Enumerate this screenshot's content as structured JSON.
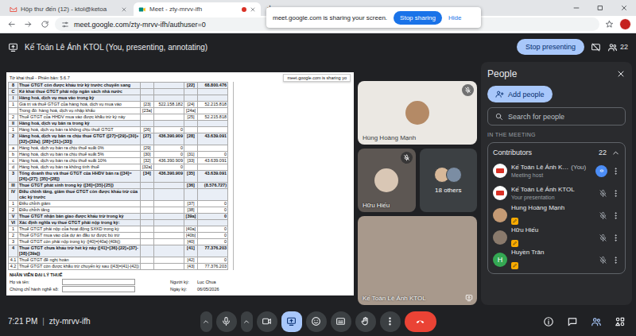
{
  "browser": {
    "tabs": [
      {
        "label": "Hộp thư đến (12) - ktol@ketoa",
        "selected": false,
        "kind": "mail",
        "recording": false
      },
      {
        "label": "Meet - zty-mrvv-ifh",
        "selected": true,
        "kind": "meet",
        "recording": true
      }
    ],
    "new_tab": "+",
    "url": "meet.google.com/zty-mrvv-ifh/authuser=0"
  },
  "share_notice": {
    "text": "meet.google.com is sharing your screen.",
    "stop": "Stop sharing",
    "hide": "Hide"
  },
  "meeting_bar": {
    "title": "Kế Toán Lê Ánh KTOL (You, presenting, annotating)",
    "stop_presenting": "Stop presenting",
    "participant_count": "22"
  },
  "document": {
    "title": "Tờ khai thuế - Phiên bản: 5.6.7",
    "notice": "meet.google.com is sharing yo",
    "rows": [
      {
        "kind": "section",
        "cells": [
          "8",
          "Thuế GTGT còn được khấu trừ kỳ trước chuyển sang",
          "",
          "",
          "[22]",
          "68.800.476"
        ]
      },
      {
        "kind": "section",
        "cells": [
          "C",
          "Kê khai thuế GTGT phải nộp ngân sách nhà nước",
          "",
          "",
          "",
          ""
        ]
      },
      {
        "kind": "section",
        "cells": [
          "I",
          "Hàng hoá, dịch vụ mua vào trong kỳ",
          "",
          "",
          "",
          ""
        ]
      },
      {
        "kind": "item",
        "cells": [
          "1",
          "Giá trị và thuế GTGT của hàng hoá, dịch vụ mua vào",
          "[23]",
          "522.158.182",
          "[24]",
          "52.215.818"
        ]
      },
      {
        "kind": "item",
        "cells": [
          "",
          "Trong đó: hàng hoá, dịch vụ nhập khẩu",
          "[23a]",
          "",
          "[24a]",
          ""
        ]
      },
      {
        "kind": "item",
        "cells": [
          "2",
          "Thuế GTGT của HHDV mua vào được khấu trừ kỳ này",
          "",
          "",
          "[25]",
          "52.215.818"
        ]
      },
      {
        "kind": "section",
        "cells": [
          "II",
          "Hàng hoá, dịch vụ bán ra trong kỳ",
          "",
          "",
          "",
          ""
        ]
      },
      {
        "kind": "item",
        "cells": [
          "1",
          "Hàng hoá, dịch vụ bán ra không chịu thuế GTGT",
          "[26]",
          "0",
          "",
          ""
        ]
      },
      {
        "kind": "section",
        "cells": [
          "2",
          "Hàng hoá, dịch vụ bán ra chịu thuế GTGT ([27]=[29]+[30]+[32]+[32a]; [28]=[31]+[33])",
          "[27]",
          "436.390.909",
          "[28]",
          "43.639.091"
        ]
      },
      {
        "kind": "item",
        "cells": [
          "a",
          "Hàng hoá, dịch vụ bán ra chịu thuế suất 0%",
          "[29]",
          "0",
          "",
          ""
        ]
      },
      {
        "kind": "item",
        "cells": [
          "b",
          "Hàng hoá, dịch vụ bán ra chịu thuế suất 5%",
          "[30]",
          "0",
          "[31]",
          "0"
        ]
      },
      {
        "kind": "item",
        "cells": [
          "c",
          "Hàng hoá, dịch vụ bán ra chịu thuế suất 10%",
          "[32]",
          "436.390.909",
          "[33]",
          "43.639.091"
        ]
      },
      {
        "kind": "item",
        "cells": [
          "d",
          "Hàng hoá, dịch vụ bán ra không tính thuế",
          "[32a]",
          "0",
          "",
          ""
        ]
      },
      {
        "kind": "section",
        "cells": [
          "3",
          "Tổng doanh thu và thuế GTGT của HHDV bán ra ([34]=[26]+[27]; [35]=[28])",
          "[34]",
          "436.390.909",
          "[35]",
          "43.639.091"
        ]
      },
      {
        "kind": "section",
        "cells": [
          "III",
          "Thuế GTGT phát sinh trong kỳ ([36]=[35]-[25])",
          "",
          "",
          "[36]",
          "(8.576.727)"
        ]
      },
      {
        "kind": "section",
        "cells": [
          "IV",
          "Điều chỉnh tăng, giảm thuế GTGT còn được khấu trừ của các kỳ trước",
          "",
          "",
          "",
          ""
        ]
      },
      {
        "kind": "item",
        "cells": [
          "1",
          "Điều chỉnh giảm",
          "",
          "",
          "[37]",
          "0"
        ]
      },
      {
        "kind": "item",
        "cells": [
          "2",
          "Điều chỉnh tăng",
          "",
          "",
          "[38]",
          "0"
        ]
      },
      {
        "kind": "section",
        "cells": [
          "V",
          "Thuế GTGT nhận bàn giao được khấu trừ trong kỳ",
          "",
          "",
          "[39a]",
          "0"
        ]
      },
      {
        "kind": "section",
        "cells": [
          "VI",
          "Xác định nghĩa vụ thuế GTGT phải nộp trong kỳ:",
          "",
          "",
          "",
          ""
        ]
      },
      {
        "kind": "item",
        "cells": [
          "1",
          "Thuế GTGT phải nộp của hoạt động SXKD trong kỳ",
          "",
          "",
          "[40a]",
          "0"
        ]
      },
      {
        "kind": "item",
        "cells": [
          "2",
          "Thuế GTGT mua vào của dự án đầu tư được bù trừ",
          "",
          "",
          "[40b]",
          "0"
        ]
      },
      {
        "kind": "item",
        "cells": [
          "3",
          "Thuế GTGT còn phải nộp trong kỳ ([40]=[40a]-[40b])",
          "",
          "",
          "[40]",
          "0"
        ]
      },
      {
        "kind": "section",
        "cells": [
          "4",
          "Thuế GTGT chưa khấu trừ hết kỳ này ([41]=[36]-[22]+[37]-[38]-[39a])",
          "",
          "",
          "[41]",
          "77.376.203"
        ]
      },
      {
        "kind": "item",
        "cells": [
          "4.1",
          "Thuế GTGT đề nghị hoàn",
          "",
          "",
          "[42]",
          "0"
        ]
      },
      {
        "kind": "item",
        "cells": [
          "4.2",
          "Thuế GTGT còn được khấu trừ chuyển kỳ sau ([43]=[41]-[42])",
          "",
          "",
          "[43]",
          "77.376.203"
        ]
      }
    ],
    "footer": {
      "heading": "NHÂN VIÊN ĐẠI LÝ THUẾ",
      "lines": [
        {
          "left_label": "Họ và tên:",
          "left_value": "",
          "right_label": "Người ký:",
          "right_value": "Lục Chua"
        },
        {
          "left_label": "Chứng chỉ hành nghề số:",
          "left_value": "",
          "right_label": "Ngày ký:",
          "right_value": "06/05/2026"
        }
      ]
    }
  },
  "tiles": [
    {
      "name": "Hùng Hoàng Mạnh",
      "kind": "avatar-light",
      "muted": true
    },
    {
      "name": "Hữu Hiếu",
      "kind": "avatar-dark",
      "muted": true
    },
    {
      "name": "18 others",
      "kind": "group",
      "muted": false
    },
    {
      "name": "Kế Toán Lê Ánh KTOL",
      "kind": "video",
      "muted": false
    }
  ],
  "people_panel": {
    "title": "People",
    "add_button": "Add people",
    "search_placeholder": "Search for people",
    "section": "IN THE MEETING",
    "group": {
      "label": "Contributors",
      "count": "22",
      "expanded": true
    },
    "members": [
      {
        "name": "Kế Toán Lê Ánh K…",
        "tag": "(You)",
        "subtitle": "Meeting host",
        "avatar": "logo",
        "speaking": true,
        "muted": false,
        "badge": false
      },
      {
        "name": "Kế Toán Lê Ánh KTOL",
        "tag": "",
        "subtitle": "Your presentation",
        "avatar": "logo",
        "speaking": false,
        "muted": true,
        "badge": false
      },
      {
        "name": "Hung Hoàng Mạnh",
        "tag": "",
        "subtitle": "",
        "avatar": "photo",
        "color": "#c49a74",
        "speaking": false,
        "muted": true,
        "badge": true
      },
      {
        "name": "Hữu Hiếu",
        "tag": "",
        "subtitle": "",
        "avatar": "photo",
        "color": "#8a7a6c",
        "speaking": false,
        "muted": true,
        "badge": true
      },
      {
        "name": "Huyền Trân",
        "tag": "",
        "subtitle": "",
        "avatar": "letter",
        "letter": "H",
        "color": "#34a853",
        "speaking": false,
        "muted": true,
        "badge": true
      }
    ]
  },
  "bottom_bar": {
    "time": "7:21 PM",
    "separator": "|",
    "code": "zty-mrvv-ifh",
    "controls": [
      {
        "kind": "chevron-up",
        "selected": false
      },
      {
        "kind": "mic",
        "selected": false
      },
      {
        "kind": "chevron-up",
        "selected": false
      },
      {
        "kind": "camera",
        "selected": false
      },
      {
        "kind": "present",
        "selected": true
      },
      {
        "kind": "emoji",
        "selected": false
      },
      {
        "kind": "captions",
        "selected": false
      },
      {
        "kind": "hand",
        "selected": false
      },
      {
        "kind": "more",
        "selected": false
      },
      {
        "kind": "end-call",
        "selected": false
      }
    ],
    "side": [
      {
        "kind": "info",
        "selected": false
      },
      {
        "kind": "chat",
        "selected": false
      },
      {
        "kind": "people",
        "selected": true
      },
      {
        "kind": "activities",
        "selected": false
      }
    ]
  }
}
